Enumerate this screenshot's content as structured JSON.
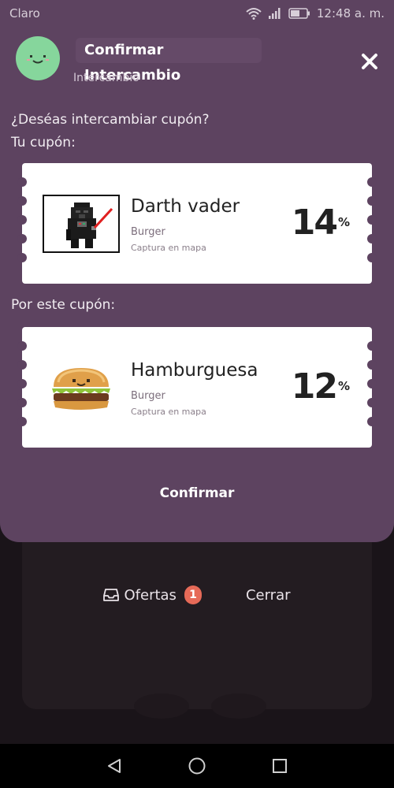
{
  "status_bar": {
    "carrier": "Claro",
    "time": "12:48 a. m."
  },
  "modal": {
    "title": "Confirmar Intercambio",
    "subtitle": "Intercambio",
    "question": "¿Deséas intercambiar cupón?",
    "your_coupon_label": "Tu cupón:",
    "for_coupon_label": "Por este cupón:",
    "confirm_label": "Confirmar"
  },
  "coupons": [
    {
      "name": "Darth vader",
      "category": "Burger",
      "note": "Captura en mapa",
      "discount": "14",
      "percent_sign": "%",
      "image_icon": "darth-vader-pixel-icon"
    },
    {
      "name": "Hamburguesa",
      "category": "Burger",
      "note": "Captura en mapa",
      "discount": "12",
      "percent_sign": "%",
      "image_icon": "hamburger-pixel-icon"
    }
  ],
  "bottom": {
    "offers_label": "Ofertas",
    "offers_count": "1",
    "close_label": "Cerrar"
  },
  "colors": {
    "modal_bg": "#5d4360",
    "avatar": "#86d69c",
    "badge": "#e66a58"
  }
}
